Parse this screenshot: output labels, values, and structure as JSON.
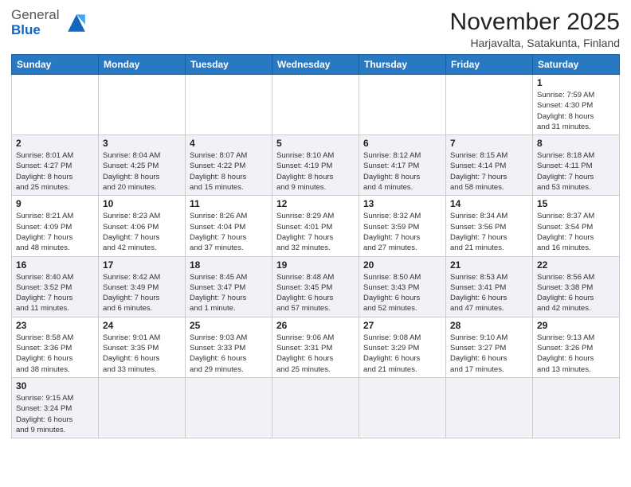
{
  "logo": {
    "general": "General",
    "blue": "Blue"
  },
  "title": "November 2025",
  "subtitle": "Harjavalta, Satakunta, Finland",
  "weekdays": [
    "Sunday",
    "Monday",
    "Tuesday",
    "Wednesday",
    "Thursday",
    "Friday",
    "Saturday"
  ],
  "rows": [
    [
      {
        "day": "",
        "info": ""
      },
      {
        "day": "",
        "info": ""
      },
      {
        "day": "",
        "info": ""
      },
      {
        "day": "",
        "info": ""
      },
      {
        "day": "",
        "info": ""
      },
      {
        "day": "",
        "info": ""
      },
      {
        "day": "1",
        "info": "Sunrise: 7:59 AM\nSunset: 4:30 PM\nDaylight: 8 hours\nand 31 minutes."
      }
    ],
    [
      {
        "day": "2",
        "info": "Sunrise: 8:01 AM\nSunset: 4:27 PM\nDaylight: 8 hours\nand 25 minutes."
      },
      {
        "day": "3",
        "info": "Sunrise: 8:04 AM\nSunset: 4:25 PM\nDaylight: 8 hours\nand 20 minutes."
      },
      {
        "day": "4",
        "info": "Sunrise: 8:07 AM\nSunset: 4:22 PM\nDaylight: 8 hours\nand 15 minutes."
      },
      {
        "day": "5",
        "info": "Sunrise: 8:10 AM\nSunset: 4:19 PM\nDaylight: 8 hours\nand 9 minutes."
      },
      {
        "day": "6",
        "info": "Sunrise: 8:12 AM\nSunset: 4:17 PM\nDaylight: 8 hours\nand 4 minutes."
      },
      {
        "day": "7",
        "info": "Sunrise: 8:15 AM\nSunset: 4:14 PM\nDaylight: 7 hours\nand 58 minutes."
      },
      {
        "day": "8",
        "info": "Sunrise: 8:18 AM\nSunset: 4:11 PM\nDaylight: 7 hours\nand 53 minutes."
      }
    ],
    [
      {
        "day": "9",
        "info": "Sunrise: 8:21 AM\nSunset: 4:09 PM\nDaylight: 7 hours\nand 48 minutes."
      },
      {
        "day": "10",
        "info": "Sunrise: 8:23 AM\nSunset: 4:06 PM\nDaylight: 7 hours\nand 42 minutes."
      },
      {
        "day": "11",
        "info": "Sunrise: 8:26 AM\nSunset: 4:04 PM\nDaylight: 7 hours\nand 37 minutes."
      },
      {
        "day": "12",
        "info": "Sunrise: 8:29 AM\nSunset: 4:01 PM\nDaylight: 7 hours\nand 32 minutes."
      },
      {
        "day": "13",
        "info": "Sunrise: 8:32 AM\nSunset: 3:59 PM\nDaylight: 7 hours\nand 27 minutes."
      },
      {
        "day": "14",
        "info": "Sunrise: 8:34 AM\nSunset: 3:56 PM\nDaylight: 7 hours\nand 21 minutes."
      },
      {
        "day": "15",
        "info": "Sunrise: 8:37 AM\nSunset: 3:54 PM\nDaylight: 7 hours\nand 16 minutes."
      }
    ],
    [
      {
        "day": "16",
        "info": "Sunrise: 8:40 AM\nSunset: 3:52 PM\nDaylight: 7 hours\nand 11 minutes."
      },
      {
        "day": "17",
        "info": "Sunrise: 8:42 AM\nSunset: 3:49 PM\nDaylight: 7 hours\nand 6 minutes."
      },
      {
        "day": "18",
        "info": "Sunrise: 8:45 AM\nSunset: 3:47 PM\nDaylight: 7 hours\nand 1 minute."
      },
      {
        "day": "19",
        "info": "Sunrise: 8:48 AM\nSunset: 3:45 PM\nDaylight: 6 hours\nand 57 minutes."
      },
      {
        "day": "20",
        "info": "Sunrise: 8:50 AM\nSunset: 3:43 PM\nDaylight: 6 hours\nand 52 minutes."
      },
      {
        "day": "21",
        "info": "Sunrise: 8:53 AM\nSunset: 3:41 PM\nDaylight: 6 hours\nand 47 minutes."
      },
      {
        "day": "22",
        "info": "Sunrise: 8:56 AM\nSunset: 3:38 PM\nDaylight: 6 hours\nand 42 minutes."
      }
    ],
    [
      {
        "day": "23",
        "info": "Sunrise: 8:58 AM\nSunset: 3:36 PM\nDaylight: 6 hours\nand 38 minutes."
      },
      {
        "day": "24",
        "info": "Sunrise: 9:01 AM\nSunset: 3:35 PM\nDaylight: 6 hours\nand 33 minutes."
      },
      {
        "day": "25",
        "info": "Sunrise: 9:03 AM\nSunset: 3:33 PM\nDaylight: 6 hours\nand 29 minutes."
      },
      {
        "day": "26",
        "info": "Sunrise: 9:06 AM\nSunset: 3:31 PM\nDaylight: 6 hours\nand 25 minutes."
      },
      {
        "day": "27",
        "info": "Sunrise: 9:08 AM\nSunset: 3:29 PM\nDaylight: 6 hours\nand 21 minutes."
      },
      {
        "day": "28",
        "info": "Sunrise: 9:10 AM\nSunset: 3:27 PM\nDaylight: 6 hours\nand 17 minutes."
      },
      {
        "day": "29",
        "info": "Sunrise: 9:13 AM\nSunset: 3:26 PM\nDaylight: 6 hours\nand 13 minutes."
      }
    ],
    [
      {
        "day": "30",
        "info": "Sunrise: 9:15 AM\nSunset: 3:24 PM\nDaylight: 6 hours\nand 9 minutes."
      },
      {
        "day": "",
        "info": ""
      },
      {
        "day": "",
        "info": ""
      },
      {
        "day": "",
        "info": ""
      },
      {
        "day": "",
        "info": ""
      },
      {
        "day": "",
        "info": ""
      },
      {
        "day": "",
        "info": ""
      }
    ]
  ]
}
